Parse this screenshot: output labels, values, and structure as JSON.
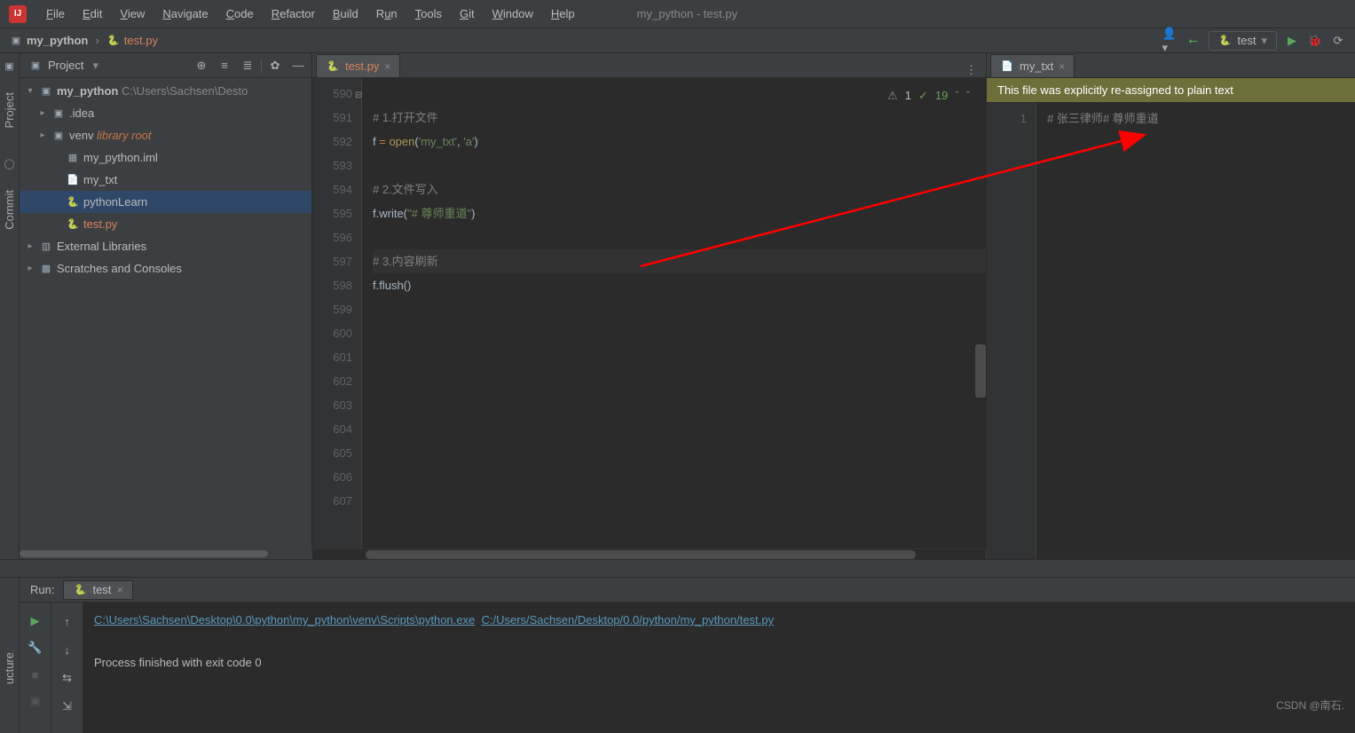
{
  "menu": {
    "items": [
      "File",
      "Edit",
      "View",
      "Navigate",
      "Code",
      "Refactor",
      "Build",
      "Run",
      "Tools",
      "Git",
      "Window",
      "Help"
    ]
  },
  "window_title": "my_python - test.py",
  "breadcrumb": {
    "project": "my_python",
    "file": "test.py"
  },
  "run_config": "test",
  "left_tools": {
    "project_label": "Project",
    "commit_label": "Commit"
  },
  "sidebar": {
    "title": "Project",
    "tree": [
      {
        "label": "my_python",
        "suffix": "C:\\Users\\Sachsen\\Desto",
        "type": "folder",
        "arrow": "▾",
        "indent": 0,
        "bold": true
      },
      {
        "label": ".idea",
        "type": "folder",
        "arrow": "▸",
        "indent": 1
      },
      {
        "label": "venv",
        "suffix": "library root",
        "type": "folder",
        "arrow": "▸",
        "indent": 1,
        "lib": true
      },
      {
        "label": "my_python.iml",
        "type": "iml",
        "indent": 2
      },
      {
        "label": "my_txt",
        "type": "file",
        "indent": 2
      },
      {
        "label": "pythonLearn",
        "type": "py",
        "indent": 2,
        "selected": true
      },
      {
        "label": "test.py",
        "type": "py",
        "indent": 2,
        "orange": true
      },
      {
        "label": "External Libraries",
        "type": "lib",
        "arrow": "▸",
        "indent": 0
      },
      {
        "label": "Scratches and Consoles",
        "type": "scratch",
        "arrow": "▸",
        "indent": 0
      }
    ]
  },
  "editor_left": {
    "tab": "test.py",
    "inspection": {
      "warn": "1",
      "weak": "19"
    },
    "first_line": 590,
    "lines": [
      {
        "n": 590,
        "text": ""
      },
      {
        "n": 591,
        "html": "<span class='comment'># 1.打开文件</span>",
        "fold": "⊟"
      },
      {
        "n": 592,
        "html": "f <span class='kw'>=</span> <span class='fn'>open</span>(<span class='str'>'my_txt'</span>, <span class='str'>'a'</span>)"
      },
      {
        "n": 593,
        "text": ""
      },
      {
        "n": 594,
        "html": "<span class='comment'># 2.文件写入</span>"
      },
      {
        "n": 595,
        "html": "f.write(<span class='str'>\"# 尊师重道\"</span>)"
      },
      {
        "n": 596,
        "text": ""
      },
      {
        "n": 597,
        "html": "<span class='comment'># 3.内容刷新</span>",
        "current": true
      },
      {
        "n": 598,
        "html": "f.flush()"
      },
      {
        "n": 599,
        "text": ""
      },
      {
        "n": 600,
        "text": ""
      },
      {
        "n": 601,
        "text": ""
      },
      {
        "n": 602,
        "text": ""
      },
      {
        "n": 603,
        "text": ""
      },
      {
        "n": 604,
        "text": ""
      },
      {
        "n": 605,
        "text": ""
      },
      {
        "n": 606,
        "text": ""
      },
      {
        "n": 607,
        "text": ""
      }
    ]
  },
  "editor_right": {
    "tab": "my_txt",
    "notice": "This file was explicitly re-assigned to plain text",
    "lines": [
      {
        "n": 1,
        "html": "<span class='comment'># 张三律师# 尊师重道</span>"
      }
    ]
  },
  "run_panel": {
    "label": "Run:",
    "tab": "test",
    "exe_path": "C:\\Users\\Sachsen\\Desktop\\0.0\\python\\my_python\\venv\\Scripts\\python.exe",
    "file_path": "C:/Users/Sachsen/Desktop/0.0/python/my_python/test.py",
    "exit_msg": "Process finished with exit code 0"
  },
  "watermark": "CSDN @南石.",
  "bottom_strip_label": "ucture"
}
